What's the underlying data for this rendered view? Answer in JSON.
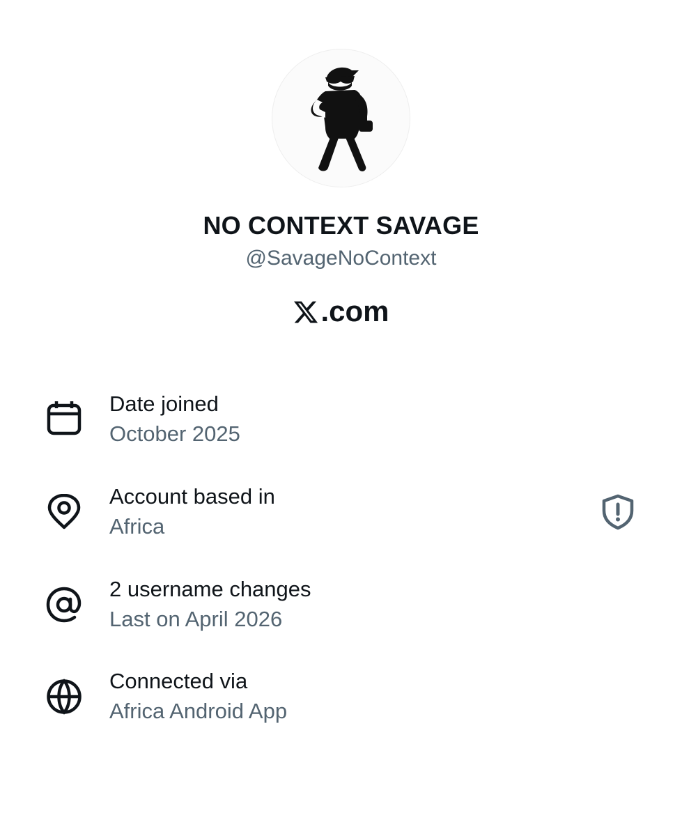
{
  "profile": {
    "display_name": "NO CONTEXT SAVAGE",
    "handle": "@SavageNoContext",
    "avatar_icon": "savage-figure-avatar"
  },
  "brand": {
    "suffix": ".com",
    "logo_icon": "x-logo-icon"
  },
  "about": [
    {
      "icon": "calendar-icon",
      "title": "Date joined",
      "value": "October 2025"
    },
    {
      "icon": "location-pin-icon",
      "title": "Account based in",
      "value": "Africa",
      "badge_icon": "shield-alert-icon"
    },
    {
      "icon": "at-sign-icon",
      "title": "2 username changes",
      "value": "Last on April 2026"
    },
    {
      "icon": "globe-icon",
      "title": "Connected via",
      "value": "Africa Android App"
    }
  ],
  "colors": {
    "primary_text": "#0f1419",
    "secondary_text": "#536471",
    "background": "#ffffff"
  }
}
